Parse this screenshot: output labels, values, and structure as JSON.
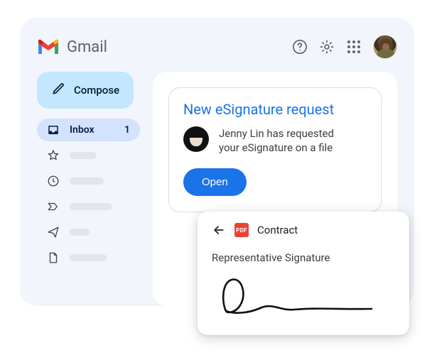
{
  "app": {
    "title": "Gmail"
  },
  "compose": {
    "label": "Compose"
  },
  "sidebar": {
    "inbox": {
      "label": "Inbox",
      "count": "1"
    }
  },
  "card": {
    "title": "New eSignature request",
    "body_line1": "Jenny Lin has requested",
    "body_line2": "your eSignature on a file",
    "open_label": "Open"
  },
  "overlay": {
    "pdf_label": "PDF",
    "doc_name": "Contract",
    "signature_label": "Representative Signature"
  }
}
